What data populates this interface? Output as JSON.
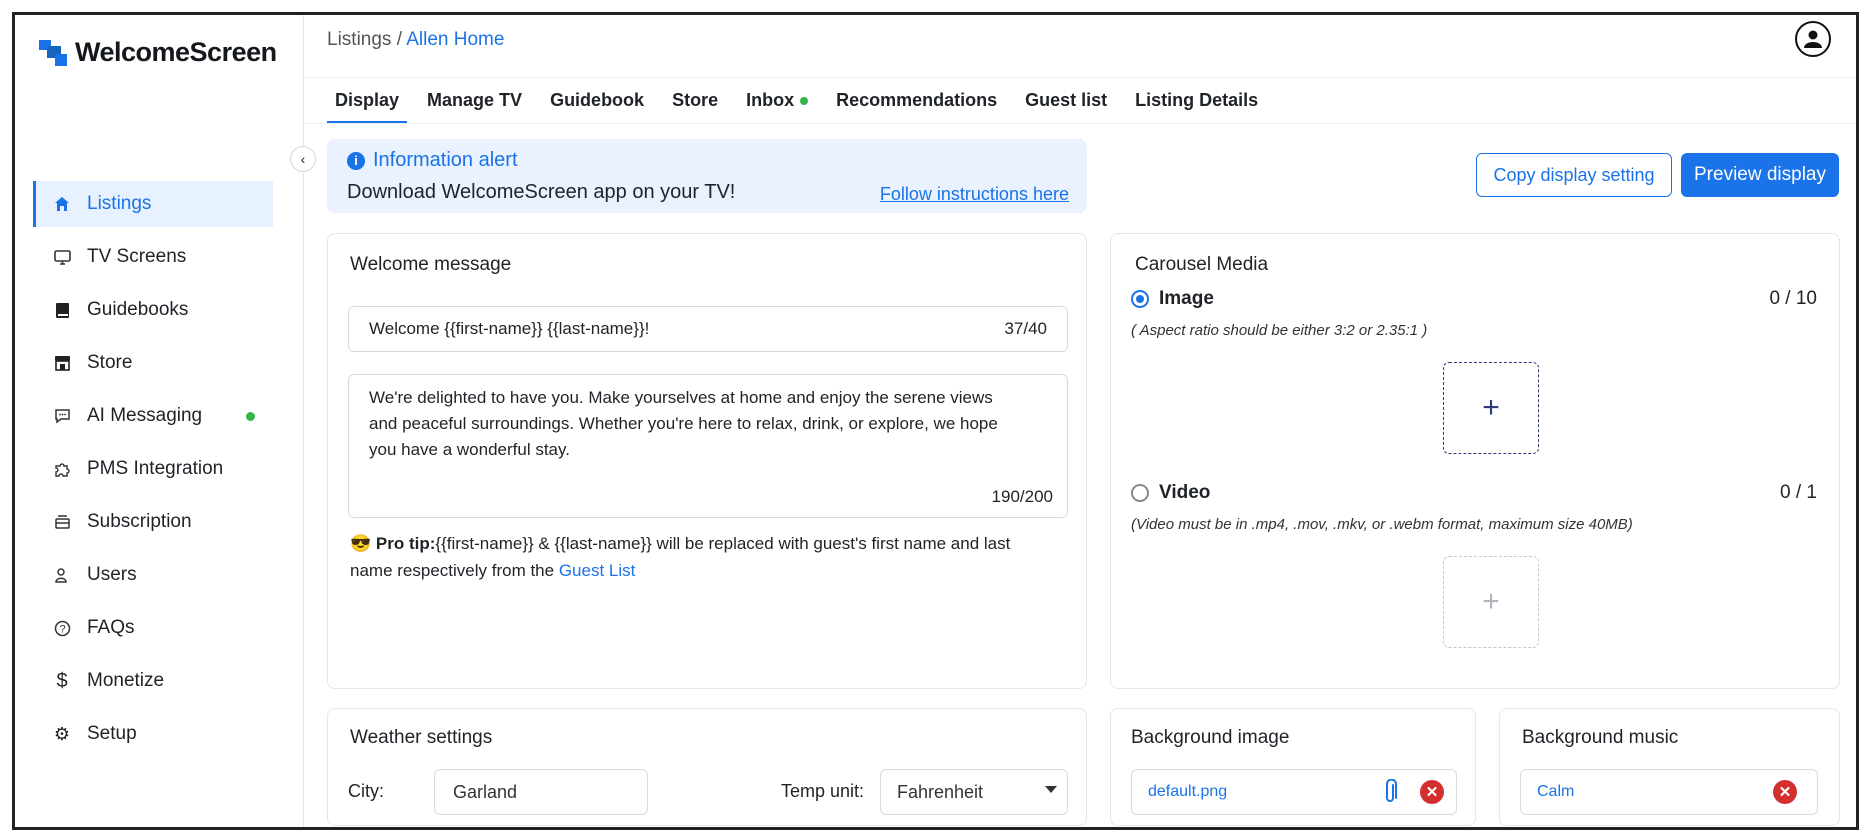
{
  "app": {
    "name": "WelcomeScreen"
  },
  "breadcrumb": {
    "parent": "Listings",
    "separator": " / ",
    "current": "Allen Home"
  },
  "sidebar": {
    "items": [
      {
        "label": "Listings",
        "icon": "home-icon"
      },
      {
        "label": "TV Screens",
        "icon": "monitor-icon"
      },
      {
        "label": "Guidebooks",
        "icon": "book-icon"
      },
      {
        "label": "Store",
        "icon": "store-icon"
      },
      {
        "label": "AI Messaging",
        "icon": "chat-icon"
      },
      {
        "label": "PMS Integration",
        "icon": "puzzle-icon"
      },
      {
        "label": "Subscription",
        "icon": "subscription-icon"
      },
      {
        "label": "Users",
        "icon": "user-icon"
      },
      {
        "label": "FAQs",
        "icon": "question-icon"
      },
      {
        "label": "Monetize",
        "icon": "dollar-icon"
      },
      {
        "label": "Setup",
        "icon": "gear-icon"
      }
    ]
  },
  "tabs": [
    {
      "label": "Display"
    },
    {
      "label": "Manage TV"
    },
    {
      "label": "Guidebook"
    },
    {
      "label": "Store"
    },
    {
      "label": "Inbox"
    },
    {
      "label": "Recommendations"
    },
    {
      "label": "Guest list"
    },
    {
      "label": "Listing Details"
    }
  ],
  "alert": {
    "title": "Information alert",
    "body": "Download WelcomeScreen app on your TV!",
    "link": "Follow instructions here"
  },
  "actions": {
    "copy": "Copy display setting",
    "preview": "Preview display"
  },
  "welcome": {
    "title": "Welcome message",
    "headline": "Welcome {{first-name}} {{last-name}}!",
    "headline_count": "37/40",
    "message": "We're delighted to have you. Make yourselves at home and enjoy the serene views and peaceful surroundings. Whether you're here to relax, drink, or explore, we hope you have a wonderful stay.",
    "message_count": "190/200",
    "tip_emoji": "😎",
    "tip_label": "Pro tip:",
    "tip_text": "{{first-name}} & {{last-name}} will be replaced with guest's first name and last name respectively from the ",
    "tip_link": "Guest List"
  },
  "carousel": {
    "title": "Carousel Media",
    "image_label": "Image",
    "image_count": "0 / 10",
    "image_hint": "( Aspect ratio should be either 3:2 or 2.35:1 )",
    "video_label": "Video",
    "video_count": "0 / 1",
    "video_hint": "(Video must be in .mp4, .mov, .mkv, or .webm format, maximum size 40MB)",
    "plus": "+"
  },
  "weather": {
    "title": "Weather settings",
    "city_label": "City:",
    "city_value": "Garland",
    "temp_label": "Temp unit:",
    "temp_value": "Fahrenheit"
  },
  "background_image": {
    "title": "Background image",
    "file": "default.png"
  },
  "background_music": {
    "title": "Background music",
    "file": "Calm"
  },
  "colors": {
    "accent": "#1a73e8",
    "status_green": "#34b34a",
    "danger": "#d32f2f"
  }
}
